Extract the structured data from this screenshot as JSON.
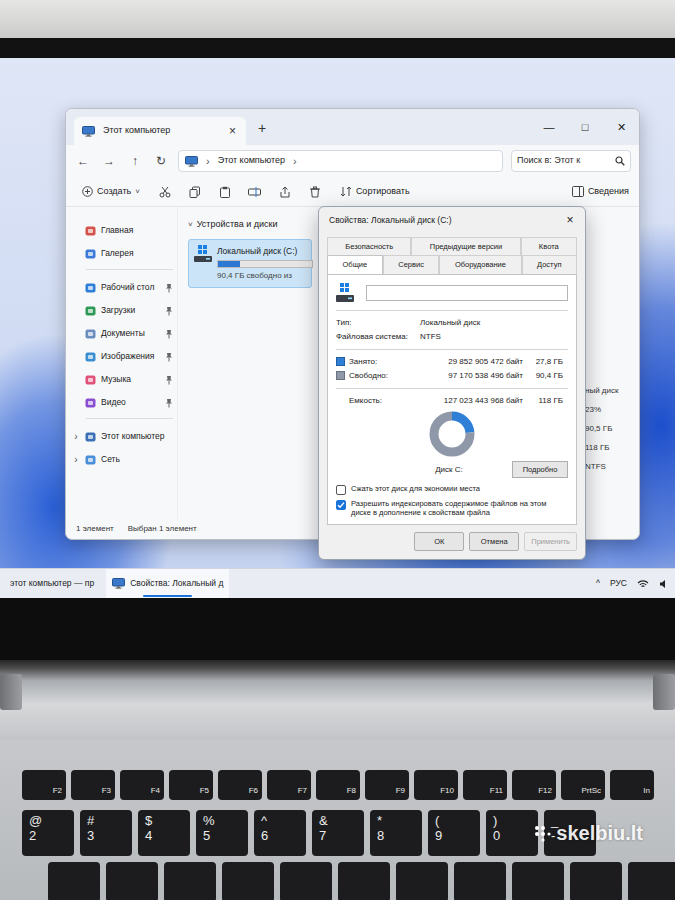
{
  "screen": {
    "explorer": {
      "tab": {
        "title": "Этот компьютер",
        "close": "×"
      },
      "new_tab": "+",
      "controls": [
        "—",
        "□",
        "✕"
      ],
      "nav": [
        "←",
        "→",
        "↑",
        "↻"
      ],
      "address": {
        "separator": "›",
        "location": "Этот компьютер",
        "trailing": "›"
      },
      "search": {
        "placeholder": "Поиск в: Этот к"
      },
      "toolbar": {
        "create": "Создать",
        "create_arrow": "˅",
        "sort": "Сортировать",
        "details": "Сведения"
      },
      "sidebar": {
        "items": [
          {
            "label": "Главная",
            "kind": "nav",
            "pinned": false
          },
          {
            "label": "Галерея",
            "kind": "nav",
            "pinned": false
          },
          {
            "label": "Рабочий стол",
            "kind": "pinned",
            "pinned": true
          },
          {
            "label": "Загрузки",
            "kind": "pinned",
            "pinned": true
          },
          {
            "label": "Документы",
            "kind": "pinned",
            "pinned": true
          },
          {
            "label": "Изображения",
            "kind": "pinned",
            "pinned": true
          },
          {
            "label": "Музыка",
            "kind": "pinned",
            "pinned": true
          },
          {
            "label": "Видео",
            "kind": "pinned",
            "pinned": true
          },
          {
            "label": "Этот компьютер",
            "kind": "tree",
            "pinned": false,
            "expander": "›"
          },
          {
            "label": "Сеть",
            "kind": "tree",
            "pinned": false,
            "expander": "›"
          }
        ]
      },
      "section": {
        "title": "Устройства и диски",
        "arrow": "˅"
      },
      "drive": {
        "name": "Локальный диск (C:)",
        "free": "90,4 ГБ свободно из",
        "level": 0.23,
        "selected": true
      },
      "details": [
        "ный диск",
        "23%",
        "90,5 ГБ",
        "118 ГБ",
        "NTFS"
      ],
      "status": [
        "1 элемент",
        "Выбран 1 элемент"
      ]
    },
    "dialog": {
      "title": "Свойства: Локальный диск (C:)",
      "close": "×",
      "tab_rows": [
        [
          {
            "label": "Безопасность",
            "selected": false
          },
          {
            "label": "Предыдущие версии",
            "selected": false
          },
          {
            "label": "Квота",
            "selected": false
          }
        ],
        [
          {
            "label": "Общие",
            "selected": true
          },
          {
            "label": "Сервис",
            "selected": false
          },
          {
            "label": "Оборудование",
            "selected": false
          },
          {
            "label": "Доступ",
            "selected": false
          }
        ]
      ],
      "name_value": "",
      "info": [
        {
          "label": "Тип:",
          "value": "Локальный диск"
        },
        {
          "label": "Файловая система:",
          "value": "NTFS"
        }
      ],
      "usage": [
        {
          "label": "Занято:",
          "bytes": "29 852 905 472 байт",
          "size": "27,8 ГБ",
          "color": "#2f7fd6"
        },
        {
          "label": "Свободно:",
          "bytes": "97 170 538 496 байт",
          "size": "90,4 ГБ",
          "color": "#8e98a8"
        }
      ],
      "capacity": {
        "label": "Емкость:",
        "bytes": "127 023 443 968 байт",
        "size": "118 ГБ"
      },
      "chart": {
        "values": [
          27.8,
          90.4
        ]
      },
      "disk_label": "Диск C:",
      "details_button": "Подробно",
      "options": [
        {
          "label": "Сжать этот диск для экономии места",
          "checked": false
        },
        {
          "label": "Разрешить индексировать содержимое файлов на этом диске в дополнение к свойствам файла",
          "checked": true
        }
      ],
      "buttons": [
        {
          "label": "ОК",
          "disabled": false
        },
        {
          "label": "Отмена",
          "disabled": false
        },
        {
          "label": "Применить",
          "disabled": true
        }
      ]
    },
    "taskbar": {
      "items": [
        {
          "label": "этот компьютер — пр",
          "selected": false
        },
        {
          "label": "Свойства: Локальный д",
          "selected": true
        }
      ],
      "chevron": "^",
      "lang": "РУС"
    }
  },
  "keyboard": {
    "function_row": [
      "F2",
      "F3",
      "F4",
      "F5",
      "F6",
      "F7",
      "F8",
      "F9",
      "F10",
      "F11",
      "F12",
      "PrtSc",
      "In"
    ],
    "number_row": [
      {
        "shift": "@",
        "key": "2"
      },
      {
        "shift": "#",
        "key": "3"
      },
      {
        "shift": "$",
        "key": "4"
      },
      {
        "shift": "%",
        "key": "5"
      },
      {
        "shift": "^",
        "key": "6"
      },
      {
        "shift": "&",
        "key": "7"
      },
      {
        "shift": "*",
        "key": "8"
      },
      {
        "shift": "(",
        "key": "9"
      },
      {
        "shift": ")",
        "key": "0"
      },
      {
        "shift": "_",
        "key": "-"
      }
    ]
  },
  "watermark": "skelbiu.lt"
}
